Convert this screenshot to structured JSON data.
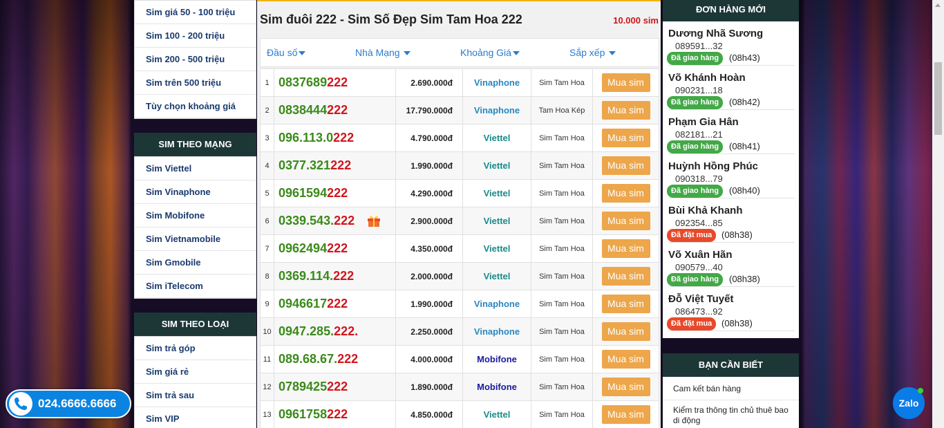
{
  "left_sidebar": {
    "price_items": [
      "Sim giá 50 - 100 triệu",
      "Sim 100 - 200 triệu",
      "Sim 200 - 500 triệu",
      "Sim trên 500 triệu",
      "Tùy chọn khoảng giá"
    ],
    "network_header": "SIM THEO MẠNG",
    "network_items": [
      "Sim Viettel",
      "Sim Vinaphone",
      "Sim Mobifone",
      "Sim Vietnamobile",
      "Sim Gmobile",
      "Sim iTelecom"
    ],
    "type_header": "SIM THEO LOẠI",
    "type_items": [
      "Sim trả góp",
      "Sim giá rẻ",
      "Sim trả sau",
      "Sim VIP"
    ]
  },
  "main": {
    "title": "Sim đuôi 222 - Sim Số Đẹp Sim Tam Hoa 222",
    "count": "10.000 sim",
    "filters": [
      "Đầu số",
      "Nhà Mạng",
      "Khoảng Giá",
      "Sắp xếp"
    ],
    "buy_label": "Mua sim",
    "rows": [
      {
        "idx": "1",
        "head": "0837689",
        "tail": "222",
        "gift": false,
        "price": "2.690.000đ",
        "network": "Vinaphone",
        "type": "Sim Tam Hoa"
      },
      {
        "idx": "2",
        "head": "0838444",
        "tail": "222",
        "gift": false,
        "price": "17.790.000đ",
        "network": "Vinaphone",
        "type": "Tam Hoa Kép"
      },
      {
        "idx": "3",
        "head": "096.113.0",
        "tail": "222",
        "gift": false,
        "price": "4.790.000đ",
        "network": "Viettel",
        "type": "Sim Tam Hoa"
      },
      {
        "idx": "4",
        "head": "0377.321",
        "tail": "222",
        "gift": false,
        "price": "1.990.000đ",
        "network": "Viettel",
        "type": "Sim Tam Hoa"
      },
      {
        "idx": "5",
        "head": "0961594",
        "tail": "222",
        "gift": false,
        "price": "4.290.000đ",
        "network": "Viettel",
        "type": "Sim Tam Hoa"
      },
      {
        "idx": "6",
        "head": "0339.543.",
        "tail": "222",
        "gift": true,
        "price": "2.900.000đ",
        "network": "Viettel",
        "type": "Sim Tam Hoa"
      },
      {
        "idx": "7",
        "head": "0962494",
        "tail": "222",
        "gift": false,
        "price": "4.350.000đ",
        "network": "Viettel",
        "type": "Sim Tam Hoa"
      },
      {
        "idx": "8",
        "head": "0369.114.",
        "tail": "222",
        "gift": false,
        "price": "2.000.000đ",
        "network": "Viettel",
        "type": "Sim Tam Hoa"
      },
      {
        "idx": "9",
        "head": "0946617",
        "tail": "222",
        "gift": false,
        "price": "1.990.000đ",
        "network": "Vinaphone",
        "type": "Sim Tam Hoa"
      },
      {
        "idx": "10",
        "head": "0947.285.",
        "tail": "222.",
        "gift": false,
        "price": "2.250.000đ",
        "network": "Vinaphone",
        "type": "Sim Tam Hoa"
      },
      {
        "idx": "11",
        "head": "089.68.67.",
        "tail": "222",
        "gift": false,
        "price": "4.000.000đ",
        "network": "Mobifone",
        "type": "Sim Tam Hoa"
      },
      {
        "idx": "12",
        "head": "0789425",
        "tail": "222",
        "gift": false,
        "price": "1.890.000đ",
        "network": "Mobifone",
        "type": "Sim Tam Hoa"
      },
      {
        "idx": "13",
        "head": "0961758",
        "tail": "222",
        "gift": false,
        "price": "4.850.000đ",
        "network": "Viettel",
        "type": "Sim Tam Hoa"
      }
    ]
  },
  "right_sidebar": {
    "orders_header": "ĐƠN HÀNG MỚI",
    "orders": [
      {
        "name": "Dương Nhã Sương",
        "phone": "089591...32",
        "status": "Đã giao hàng",
        "status_color": "#43a847",
        "time": "(08h43)"
      },
      {
        "name": "Võ Khánh Hoàn",
        "phone": "090231...18",
        "status": "Đã giao hàng",
        "status_color": "#43a847",
        "time": "(08h42)"
      },
      {
        "name": "Phạm Gia Hân",
        "phone": "082181...21",
        "status": "Đã giao hàng",
        "status_color": "#43a847",
        "time": "(08h41)"
      },
      {
        "name": "Huỳnh Hồng Phúc",
        "phone": "090318...79",
        "status": "Đã giao hàng",
        "status_color": "#43a847",
        "time": "(08h40)"
      },
      {
        "name": "Bùi Khả Khanh",
        "phone": "092354...85",
        "status": "Đã đặt mua",
        "status_color": "#e8492b",
        "time": "(08h38)"
      },
      {
        "name": "Võ Xuân Hãn",
        "phone": "090579...40",
        "status": "Đã giao hàng",
        "status_color": "#43a847",
        "time": "(08h38)"
      },
      {
        "name": "Đỗ Việt Tuyết",
        "phone": "086473...92",
        "status": "Đã đặt mua",
        "status_color": "#e8492b",
        "time": "(08h38)"
      }
    ],
    "info_header": "BẠN CẦN BIẾT",
    "info_items": [
      "Cam kết bán hàng",
      "Kiểm tra thông tin chủ thuê bao di động"
    ]
  },
  "hotline": "024.6666.6666",
  "zalo_label": "Zalo",
  "colors": {
    "accent_orange": "#eda64a",
    "header_dark": "#1d3737",
    "sim_green": "#3a8a1a",
    "sim_red": "#d0151c"
  }
}
